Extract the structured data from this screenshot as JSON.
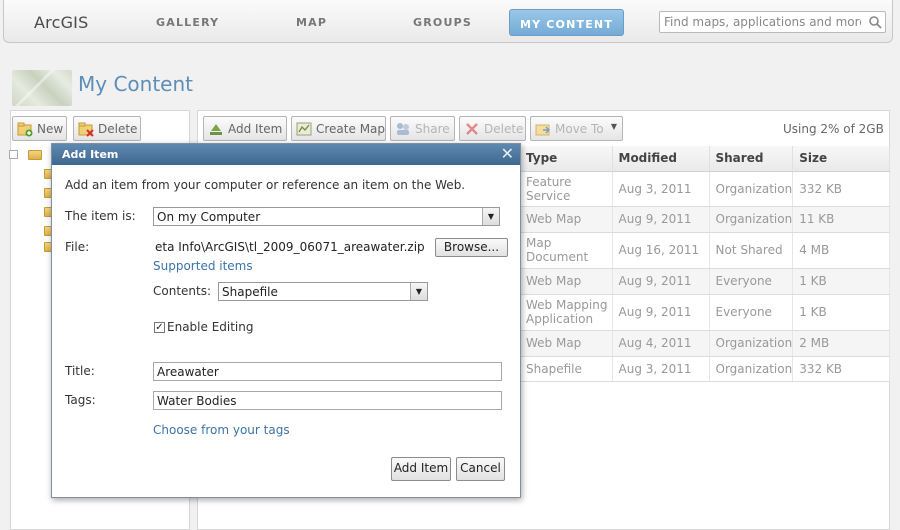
{
  "nav": {
    "brand": "ArcGIS",
    "tabs": [
      "GALLERY",
      "MAP",
      "GROUPS",
      "MY CONTENT"
    ],
    "active_tab": "MY CONTENT",
    "search_placeholder": "Find maps, applications and more..."
  },
  "page": {
    "title": "My Content"
  },
  "left_toolbar": {
    "new_label": "New",
    "delete_label": "Delete"
  },
  "toolbar": {
    "add_item": "Add Item",
    "create_map": "Create Map",
    "share": "Share",
    "delete": "Delete",
    "move_to": "Move To",
    "usage": "Using 2% of 2GB"
  },
  "table": {
    "headers": [
      "Type",
      "Modified",
      "Shared",
      "Size"
    ],
    "rows": [
      [
        "Feature Service",
        "Aug 3, 2011",
        "Organization",
        "332 KB"
      ],
      [
        "Web Map",
        "Aug 9, 2011",
        "Organization",
        "11 KB"
      ],
      [
        "Map Document",
        "Aug 16, 2011",
        "Not Shared",
        "4 MB"
      ],
      [
        "Web Map",
        "Aug 9, 2011",
        "Everyone",
        "1 KB"
      ],
      [
        "Web Mapping Application",
        "Aug 9, 2011",
        "Everyone",
        "1 KB"
      ],
      [
        "Web Map",
        "Aug 4, 2011",
        "Organization",
        "2 MB"
      ],
      [
        "Shapefile",
        "Aug 3, 2011",
        "Organization",
        "332 KB"
      ]
    ]
  },
  "dialog": {
    "title": "Add Item",
    "intro": "Add an item from your computer or reference an item on the Web.",
    "item_is_label": "The item is:",
    "item_is_value": "On my Computer",
    "file_label": "File:",
    "file_value": "eta Info\\ArcGIS\\tl_2009_06071_areawater.zip",
    "browse_label": "Browse...",
    "supported_items": "Supported items",
    "contents_label": "Contents:",
    "contents_value": "Shapefile",
    "enable_editing": "Enable Editing",
    "enable_editing_checked": true,
    "title_label": "Title:",
    "title_value": "Areawater",
    "tags_label": "Tags:",
    "tags_value": "Water Bodies",
    "choose_tags": "Choose from your tags",
    "add_item_button": "Add Item",
    "cancel_button": "Cancel"
  }
}
